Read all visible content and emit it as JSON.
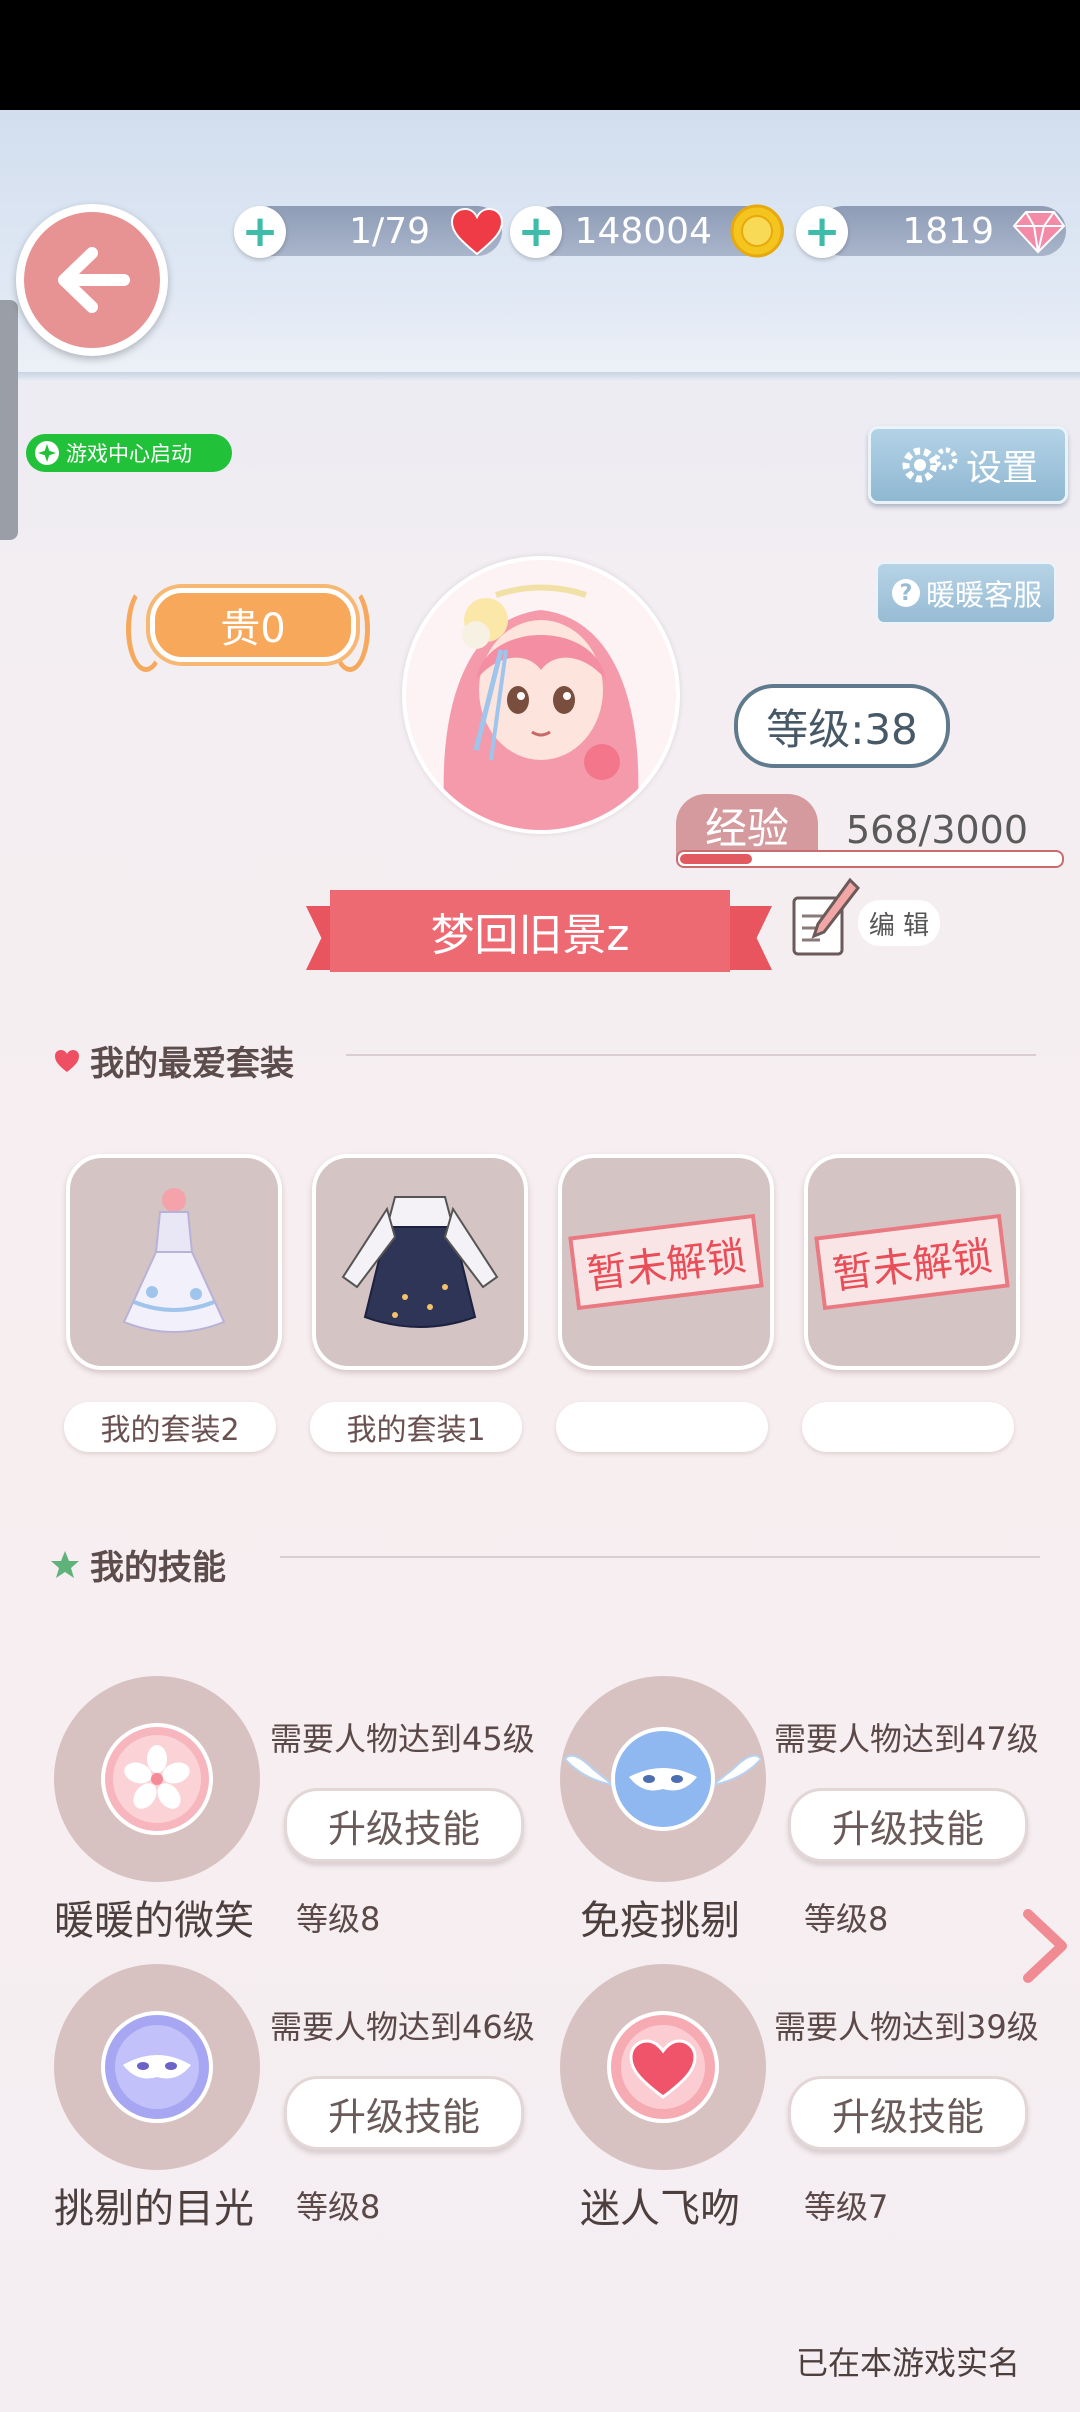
{
  "resources": {
    "hearts": "1/79",
    "coins": "148004",
    "diamonds": "1819",
    "heart_icon": "heart-icon",
    "coin_icon": "coin-icon",
    "diamond_icon": "diamond-icon"
  },
  "game_center": {
    "label": "游戏中心启动"
  },
  "settings": {
    "label": "设置"
  },
  "customer_service": {
    "label": "暖暖客服"
  },
  "profile": {
    "noble_badge": "贵0",
    "level": "等级:38",
    "exp_label": "经验",
    "exp_value": "568/3000",
    "exp_progress": 0.1893,
    "nickname": "梦回旧景z",
    "edit_label": "编 辑"
  },
  "favorites": {
    "title": "我的最爱套装",
    "outfits": [
      {
        "label": "我的套装2",
        "locked": false
      },
      {
        "label": "我的套装1",
        "locked": false
      },
      {
        "label": "",
        "locked": true,
        "stamp": "暂未解锁"
      },
      {
        "label": "",
        "locked": true,
        "stamp": "暂未解锁"
      }
    ]
  },
  "skills": {
    "title": "我的技能",
    "upgrade_label": "升级技能",
    "items": [
      {
        "name": "暖暖的微笑",
        "level": "等级8",
        "requirement": "需要人物达到45级",
        "icon": "sakura-icon"
      },
      {
        "name": "免疫挑剔",
        "level": "等级8",
        "requirement": "需要人物达到47级",
        "icon": "winged-mask-icon"
      },
      {
        "name": "挑剔的目光",
        "level": "等级8",
        "requirement": "需要人物达到46级",
        "icon": "purple-mask-icon"
      },
      {
        "name": "迷人飞吻",
        "level": "等级7",
        "requirement": "需要人物达到39级",
        "icon": "heart-orb-icon"
      }
    ]
  },
  "footer": {
    "realname_status": "已在本游戏实名"
  },
  "colors": {
    "accent_pink": "#ee6a73",
    "teal_plus": "#3fbca9",
    "green_badge": "#22c13a"
  }
}
